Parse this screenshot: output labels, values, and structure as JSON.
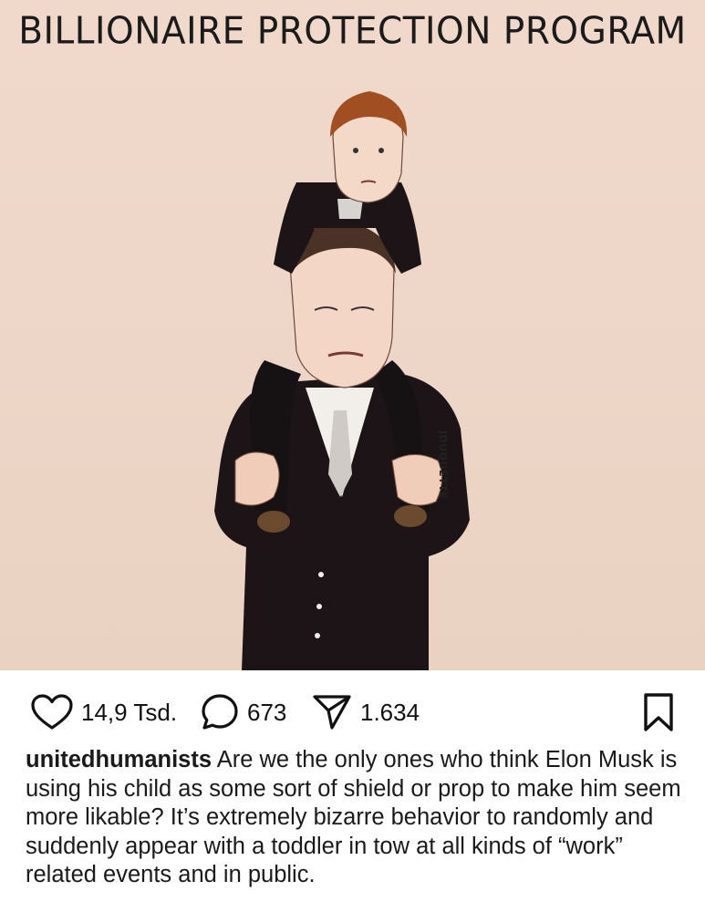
{
  "post": {
    "title": "BILLIONAIRE PROTECTION PROGRAM",
    "signature": "JDUQUETTE"
  },
  "actions": {
    "likes": "14,9 Tsd.",
    "comments": "673",
    "shares": "1.634"
  },
  "icons": {
    "like": "heart-icon",
    "comment": "comment-bubble-icon",
    "share": "paper-plane-icon",
    "save": "bookmark-icon"
  },
  "caption": {
    "username": "unitedhumanists",
    "text": "Are we the only ones who think Elon Musk is using his child as some sort of shield or prop to make him seem more likable? It’s extremely bizarre behavior to randomly and suddenly appear with a toddler in tow at all kinds of “work” related events and in public."
  }
}
